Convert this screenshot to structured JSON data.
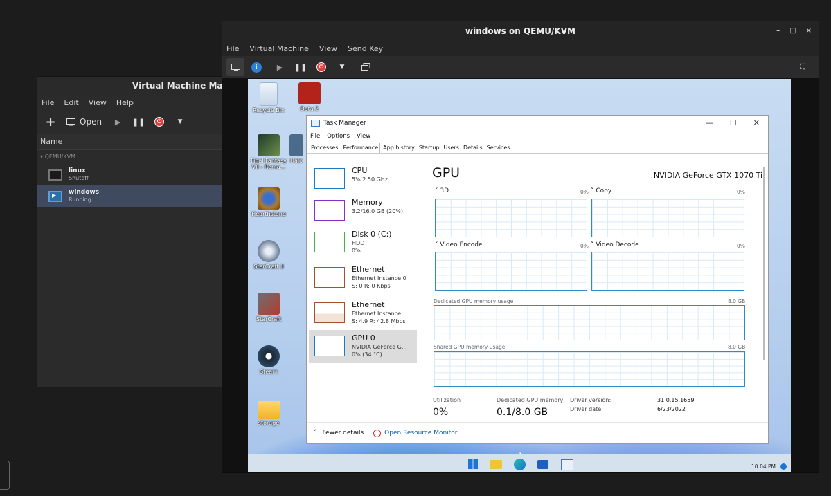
{
  "vmm": {
    "title": "Virtual Machine Manag",
    "menu": [
      "File",
      "Edit",
      "View",
      "Help"
    ],
    "toolbar": {
      "open_label": "Open"
    },
    "column_header": "Name",
    "group": "QEMU/KVM",
    "vms": [
      {
        "name": "linux",
        "status": "Shutoff"
      },
      {
        "name": "windows",
        "status": "Running"
      }
    ]
  },
  "qemu": {
    "title": "windows on QEMU/KVM",
    "menu": [
      "File",
      "Virtual Machine",
      "View",
      "Send Key"
    ],
    "window_buttons": [
      "–",
      "□",
      "×"
    ]
  },
  "desktop": {
    "icons": [
      "Recycle Bin",
      "Dota 2",
      "Final Fantasy VII - Rema...",
      "Halo",
      "Hearthstone",
      "StarCraft II",
      "StarCraft",
      "Steam",
      "storage"
    ]
  },
  "taskmgr": {
    "title": "Task Manager",
    "menu": [
      "File",
      "Options",
      "View"
    ],
    "tabs": [
      "Processes",
      "Performance",
      "App history",
      "Startup",
      "Users",
      "Details",
      "Services"
    ],
    "sidebar": [
      {
        "name": "CPU",
        "l1": "5%  2.50 GHz",
        "l2": "",
        "color": "#1f7bc1"
      },
      {
        "name": "Memory",
        "l1": "3.2/16.0 GB (20%)",
        "l2": "",
        "color": "#8b2fc9"
      },
      {
        "name": "Disk 0 (C:)",
        "l1": "HDD",
        "l2": "0%",
        "color": "#4caf50"
      },
      {
        "name": "Ethernet",
        "l1": "Ethernet Instance 0",
        "l2": "S: 0  R: 0 Kbps",
        "color": "#a0522d"
      },
      {
        "name": "Ethernet",
        "l1": "Ethernet Instance ...",
        "l2": "S: 4.9  R: 42.8 Mbps",
        "color": "#a0522d"
      },
      {
        "name": "GPU 0",
        "l1": "NVIDIA GeForce G...",
        "l2": "0%  (34 °C)",
        "color": "#1f7bc1"
      }
    ],
    "gpu": {
      "title": "GPU",
      "model": "NVIDIA GeForce GTX 1070 Ti",
      "engines": [
        {
          "label": "3D",
          "pct": "0%"
        },
        {
          "label": "Copy",
          "pct": "0%"
        },
        {
          "label": "Video Encode",
          "pct": "0%"
        },
        {
          "label": "Video Decode",
          "pct": "0%"
        }
      ],
      "dedicated_label": "Dedicated GPU memory usage",
      "dedicated_max": "8.0 GB",
      "shared_label": "Shared GPU memory usage",
      "shared_max": "8.0 GB",
      "utilization_label": "Utilization",
      "utilization_value": "0%",
      "dedicated_mem_label": "Dedicated GPU memory",
      "dedicated_mem_value": "0.1/8.0 GB",
      "driver_version_label": "Driver version:",
      "driver_version": "31.0.15.1659",
      "driver_date_label": "Driver date:",
      "driver_date": "6/23/2022"
    },
    "footer": {
      "fewer": "Fewer details",
      "resmon": "Open Resource Monitor"
    }
  },
  "taskbar": {
    "time": "10:04 PM"
  }
}
